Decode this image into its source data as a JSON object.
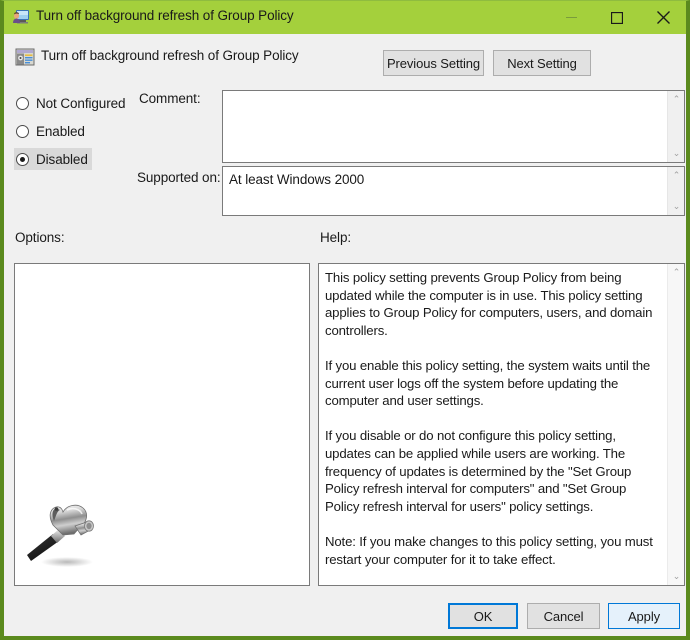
{
  "window": {
    "title": "Turn off background refresh of Group Policy",
    "title_icon": "group-policy-computer-icon",
    "accent_color": "#a4d03c",
    "border_color": "#5b8a1e",
    "controls": {
      "minimize_label": "Minimize",
      "maximize_label": "Maximize",
      "close_label": "Close"
    }
  },
  "header": {
    "icon": "policy-setting-icon",
    "title": "Turn off background refresh of Group Policy",
    "previous_setting_label": "Previous Setting",
    "next_setting_label": "Next Setting"
  },
  "state_options": {
    "items": [
      {
        "label": "Not Configured",
        "selected": false,
        "highlighted": false
      },
      {
        "label": "Enabled",
        "selected": false,
        "highlighted": false
      },
      {
        "label": "Disabled",
        "selected": true,
        "highlighted": true
      }
    ]
  },
  "comment": {
    "label": "Comment:",
    "value": "",
    "placeholder": ""
  },
  "supported_on": {
    "label": "Supported on:",
    "value": "At least Windows 2000"
  },
  "options": {
    "label": "Options:",
    "content": "",
    "icon": "hammer-icon"
  },
  "help": {
    "label": "Help:",
    "text": "This policy setting prevents Group Policy from being updated while the computer is in use. This policy setting applies to Group Policy for computers, users, and domain controllers.\n\nIf you enable this policy setting, the system waits until the current user logs off the system before updating the computer and user settings.\n\nIf you disable or do not configure this policy setting, updates can be applied while users are working. The frequency of updates is determined by the \"Set Group Policy refresh interval for computers\" and \"Set Group Policy refresh interval for users\" policy settings.\n\nNote: If you make changes to this policy setting, you must restart your computer for it to take effect."
  },
  "footer": {
    "ok_label": "OK",
    "cancel_label": "Cancel",
    "apply_label": "Apply",
    "default_button": "OK",
    "focus_color": "#0078d7"
  },
  "scrollbars": {
    "up_arrow_glyph": "⌃",
    "down_arrow_glyph": "⌄"
  }
}
